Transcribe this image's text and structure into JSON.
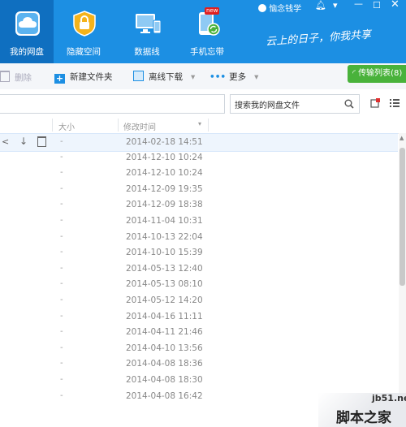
{
  "top_tabs": [
    {
      "label": "我的网盘",
      "icon": "cloud-icon",
      "active": true
    },
    {
      "label": "隐藏空间",
      "icon": "lock-icon",
      "active": false
    },
    {
      "label": "数据线",
      "icon": "devices-icon",
      "active": false
    },
    {
      "label": "手机忘带",
      "icon": "phone-sync-icon",
      "active": false
    }
  ],
  "new_badge": "new",
  "user": {
    "name": "恼念钱学"
  },
  "slogan": "云上的日子，你我共享",
  "toolbar": {
    "delete_label": "删除",
    "new_folder_label": "新建文件夹",
    "offline_download_label": "离线下载",
    "more_label": "更多",
    "transfer_list_label": "传输列表(8)"
  },
  "search": {
    "placeholder": "搜索我的网盘文件"
  },
  "columns": {
    "size": "大小",
    "modified": "修改时间"
  },
  "rows": [
    {
      "size": "-",
      "modified": "2014-02-18 14:51"
    },
    {
      "size": "-",
      "modified": "2014-12-10 10:24"
    },
    {
      "size": "-",
      "modified": "2014-12-10 10:24"
    },
    {
      "size": "-",
      "modified": "2014-12-09 19:35"
    },
    {
      "size": "-",
      "modified": "2014-12-09 18:38"
    },
    {
      "size": "-",
      "modified": "2014-11-04 10:31"
    },
    {
      "size": "-",
      "modified": "2014-10-13 22:04"
    },
    {
      "size": "-",
      "modified": "2014-10-10 15:39"
    },
    {
      "size": "-",
      "modified": "2014-05-13 12:40"
    },
    {
      "size": "-",
      "modified": "2014-05-13 08:10"
    },
    {
      "size": "-",
      "modified": "2014-05-12 14:20"
    },
    {
      "size": "-",
      "modified": "2014-04-16 11:11"
    },
    {
      "size": "-",
      "modified": "2014-04-11 21:46"
    },
    {
      "size": "-",
      "modified": "2014-04-10 13:56"
    },
    {
      "size": "-",
      "modified": "2014-04-08 18:36"
    },
    {
      "size": "-",
      "modified": "2014-04-08 18:30"
    },
    {
      "size": "-",
      "modified": "2014-04-08 16:42"
    }
  ],
  "watermark": {
    "line1": "jb51.net",
    "line2": "脚本之家"
  },
  "colors": {
    "brand_blue": "#1c8fe3",
    "active_tab": "#0f6fc0",
    "transfer_green": "#49b23b"
  }
}
